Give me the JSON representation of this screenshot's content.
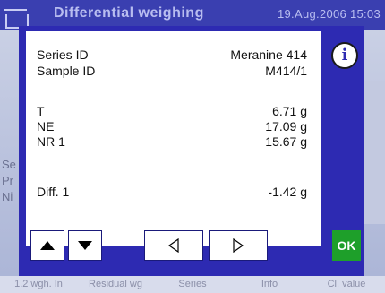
{
  "titlebar": {
    "title": "Differential weighing",
    "datetime": "19.Aug.2006  15:03"
  },
  "background": {
    "left_letters": [
      "Se",
      "Pr",
      "Ni"
    ],
    "softkeys": [
      "1.2 wgh. In",
      "Residual wg",
      "Series",
      "Info",
      "Cl. value"
    ]
  },
  "dialog": {
    "info_symbol": "i",
    "ok_label": "OK",
    "rows": [
      {
        "label": "Series ID",
        "value": "Meranine 414"
      },
      {
        "label": "Sample ID",
        "value": "M414/1"
      },
      {
        "label": "T",
        "value": "6.71 g"
      },
      {
        "label": "NE",
        "value": "17.09 g"
      },
      {
        "label": "NR 1",
        "value": "15.67 g"
      },
      {
        "label": "Diff. 1",
        "value": "-1.42 g"
      }
    ]
  },
  "icons": {
    "up": "triangle-up-icon",
    "down": "triangle-down-icon",
    "left": "triangle-left-icon",
    "right": "triangle-right-icon",
    "info": "info-icon",
    "scale": "scale-icon"
  },
  "colors": {
    "dialog_frame": "#2d2ab2",
    "ok_button": "#1e9f2a",
    "titlebar": "#3a3fb0"
  }
}
